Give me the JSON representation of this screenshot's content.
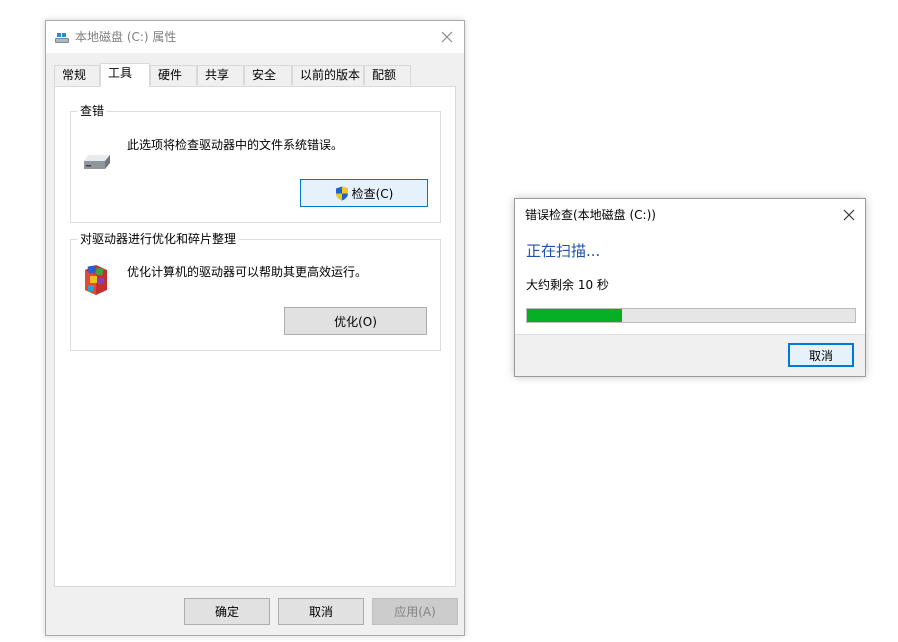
{
  "properties_window": {
    "title": "本地磁盘 (C:) 属性",
    "tabs": [
      {
        "label": "常规",
        "active": false
      },
      {
        "label": "工具",
        "active": true
      },
      {
        "label": "硬件",
        "active": false
      },
      {
        "label": "共享",
        "active": false
      },
      {
        "label": "安全",
        "active": false
      },
      {
        "label": "以前的版本",
        "active": false
      },
      {
        "label": "配额",
        "active": false
      }
    ],
    "error_checking": {
      "legend": "查错",
      "description": "此选项将检查驱动器中的文件系统错误。",
      "check_button": "检查(C)"
    },
    "optimize": {
      "legend": "对驱动器进行优化和碎片整理",
      "description": "优化计算机的驱动器可以帮助其更高效运行。",
      "optimize_button": "优化(O)"
    },
    "footer": {
      "ok": "确定",
      "cancel": "取消",
      "apply": "应用(A)"
    }
  },
  "error_check_dialog": {
    "title": "错误检查(本地磁盘 (C:))",
    "status": "正在扫描...",
    "remaining": "大约剩余 10 秒",
    "progress": 0.29,
    "cancel": "取消"
  },
  "colors": {
    "progress_fill": "#06b025",
    "heading_blue": "#1d4fb0",
    "focus_border": "#0078d7"
  },
  "icons": [
    "drive-title-icon",
    "close-icon",
    "hard-drive-icon",
    "uac-shield-icon",
    "defrag-icon"
  ]
}
